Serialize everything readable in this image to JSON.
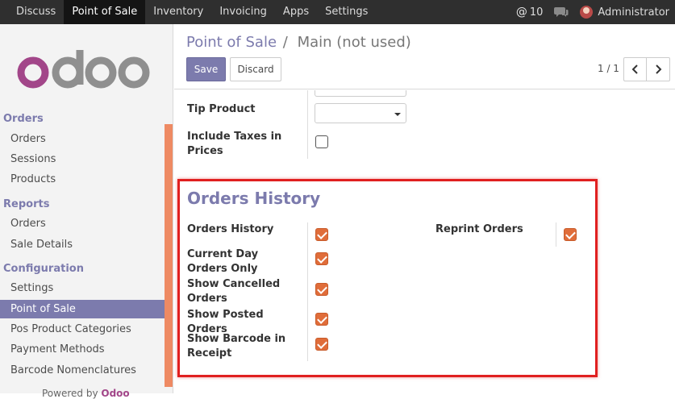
{
  "topbar": {
    "menu": [
      "Discuss",
      "Point of Sale",
      "Inventory",
      "Invoicing",
      "Apps",
      "Settings"
    ],
    "active_index": 1,
    "mentions_count": "10",
    "user": "Administrator"
  },
  "sidebar": {
    "sections": [
      {
        "title": "Orders",
        "items": [
          "Orders",
          "Sessions",
          "Products"
        ]
      },
      {
        "title": "Reports",
        "items": [
          "Orders",
          "Sale Details"
        ]
      },
      {
        "title": "Configuration",
        "items": [
          "Settings",
          "Point of Sale",
          "Pos Product Categories",
          "Payment Methods",
          "Barcode Nomenclatures"
        ]
      }
    ],
    "active_item": "Point of Sale",
    "powered_by_prefix": "Powered by",
    "powered_by_brand": "Odoo"
  },
  "breadcrumb": {
    "parent": "Point of Sale",
    "separator": "/",
    "current": "Main (not used)"
  },
  "buttons": {
    "save": "Save",
    "discard": "Discard"
  },
  "pager": {
    "value": "1 / 1"
  },
  "form": {
    "tip_product_label": "Tip Product",
    "tip_product_value": "",
    "include_taxes_label": "Include Taxes in Prices",
    "include_taxes_checked": false,
    "section_title": "Orders History",
    "fields": [
      {
        "label": "Orders History",
        "checked": true
      },
      {
        "label": "Current Day Orders Only",
        "checked": true
      },
      {
        "label": "Show Cancelled Orders",
        "checked": true
      },
      {
        "label": "Show Posted Orders",
        "checked": true
      },
      {
        "label": "Show Barcode in Receipt",
        "checked": true
      }
    ],
    "right_field": {
      "label": "Reprint Orders",
      "checked": true
    }
  },
  "colors": {
    "brand": "#7c7bad",
    "checkbox": "#e06d3a",
    "highlight": "#e02020",
    "navbar": "#2f2f2f"
  }
}
